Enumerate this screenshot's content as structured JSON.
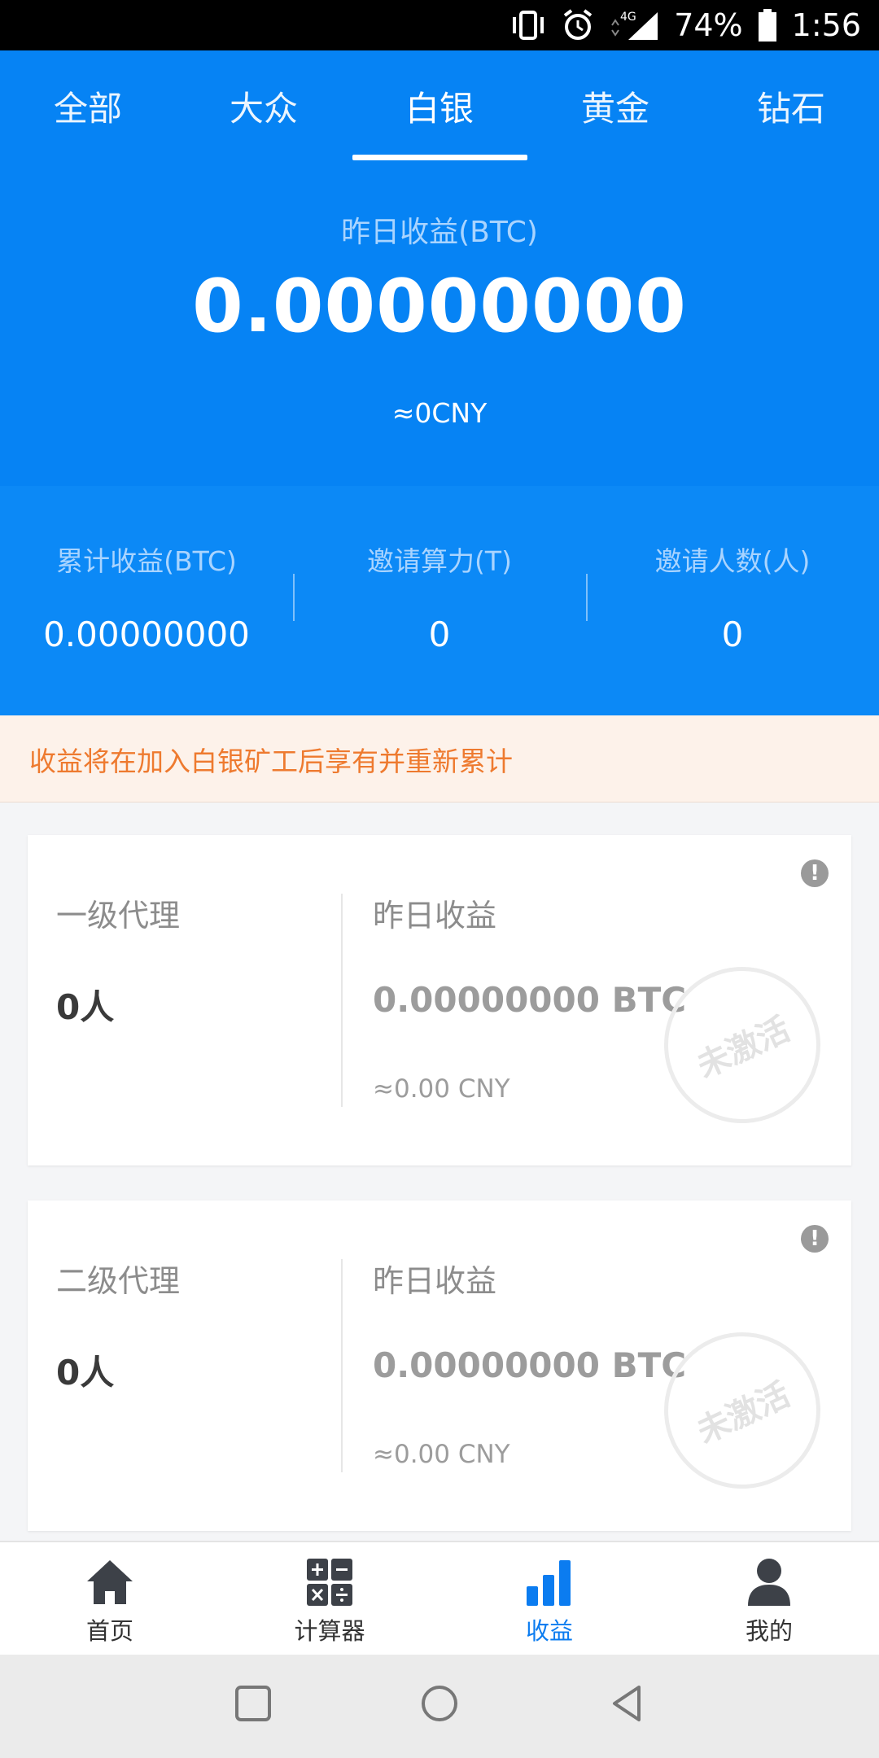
{
  "status_bar": {
    "battery_percent": "74%",
    "time": "1:56",
    "network": "4G"
  },
  "tabs": [
    {
      "label": "全部"
    },
    {
      "label": "大众"
    },
    {
      "label": "白银"
    },
    {
      "label": "黄金"
    },
    {
      "label": "钻石"
    }
  ],
  "active_tab": "白银",
  "yesterday": {
    "label": "昨日收益(BTC)",
    "value": "0.00000000",
    "cny": "≈0CNY"
  },
  "stats": [
    {
      "label": "累计收益(BTC)",
      "value": "0.00000000"
    },
    {
      "label": "邀请算力(T)",
      "value": "0"
    },
    {
      "label": "邀请人数(人)",
      "value": "0"
    }
  ],
  "notice": "收益将在加入白银矿工后享有并重新累计",
  "cards": [
    {
      "level": "一级代理",
      "count": "0人",
      "yest_label": "昨日收益",
      "btc": "0.00000000 BTC",
      "cny": "≈0.00 CNY",
      "stamp": "未激活"
    },
    {
      "level": "二级代理",
      "count": "0人",
      "yest_label": "昨日收益",
      "btc": "0.00000000 BTC",
      "cny": "≈0.00 CNY",
      "stamp": "未激活"
    }
  ],
  "nav": [
    {
      "label": "首页",
      "icon": "home-icon"
    },
    {
      "label": "计算器",
      "icon": "calculator-icon"
    },
    {
      "label": "收益",
      "icon": "bar-chart-icon"
    },
    {
      "label": "我的",
      "icon": "person-icon"
    }
  ],
  "active_nav": "收益",
  "colors": {
    "primary": "#0683f4",
    "notice_text": "#ee7a2f",
    "notice_bg": "#fdf2ea",
    "active_nav": "#0b7cf0"
  }
}
